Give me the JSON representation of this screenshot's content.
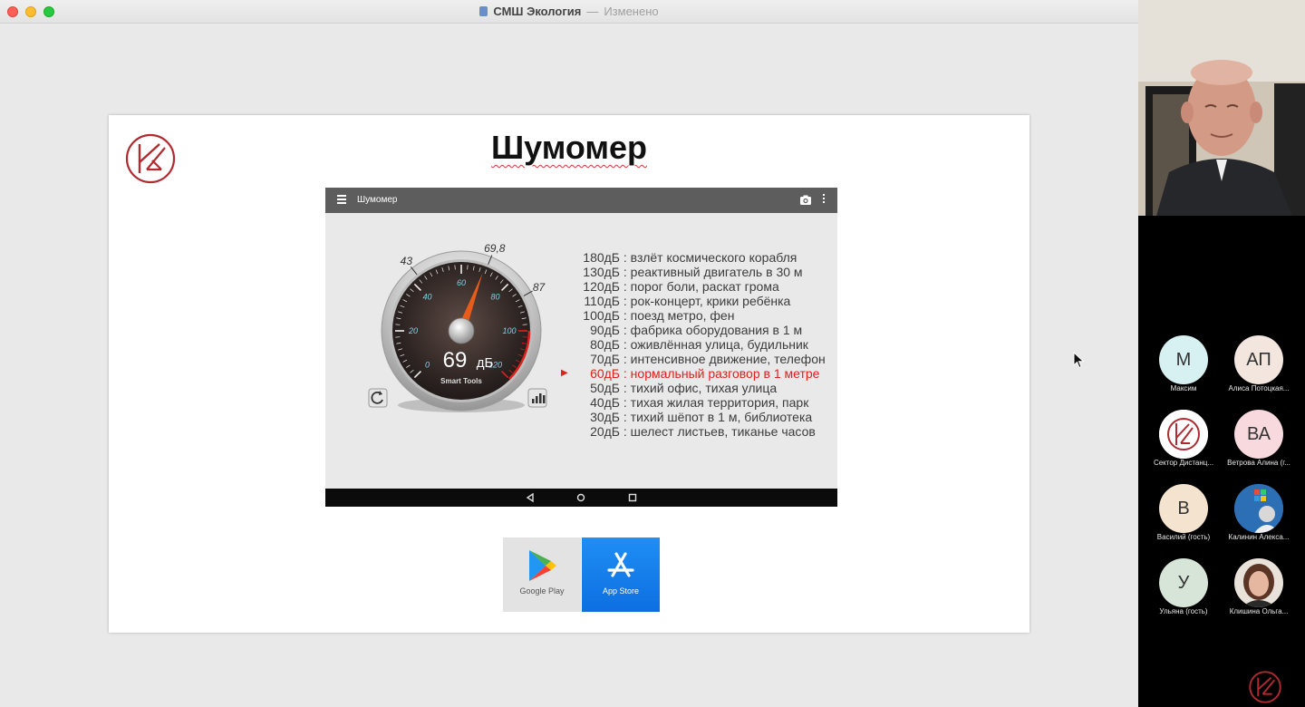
{
  "window": {
    "title": "СМШ Экология",
    "separator": "—",
    "state": "Изменено",
    "accent": "#ff5f57"
  },
  "slide": {
    "title": "Шумомер",
    "logo_icon": "sector-logo-icon",
    "brand_color": "#b02a30"
  },
  "app": {
    "title": "Шумомер",
    "gauge": {
      "reading": "69",
      "unit": "дБ",
      "brand": "Smart Tools",
      "scale": [
        "0",
        "20",
        "40",
        "60",
        "80",
        "100",
        "120"
      ],
      "outer_marks": [
        "43",
        "69,8",
        "87"
      ],
      "needle_value": 69
    },
    "levels": [
      {
        "value": "180дБ",
        "text": ": взлёт космического корабля",
        "active": false
      },
      {
        "value": "130дБ",
        "text": ": реактивный двигатель в 30 м",
        "active": false
      },
      {
        "value": "120дБ",
        "text": ": порог боли, раскат грома",
        "active": false
      },
      {
        "value": "110дБ",
        "text": ": рок-концерт, крики ребёнка",
        "active": false
      },
      {
        "value": "100дБ",
        "text": ": поезд метро, фен",
        "active": false
      },
      {
        "value": "90дБ",
        "text": ": фабрика оборудования в 1 м",
        "active": false
      },
      {
        "value": "80дБ",
        "text": ": оживлённая улица, будильник",
        "active": false
      },
      {
        "value": "70дБ",
        "text": ": интенсивное движение, телефон",
        "active": false
      },
      {
        "value": "60дБ",
        "text": ": нормальный разговор в 1 метре",
        "active": true
      },
      {
        "value": "50дБ",
        "text": ": тихий офис, тихая улица",
        "active": false
      },
      {
        "value": "40дБ",
        "text": ": тихая жилая территория, парк",
        "active": false
      },
      {
        "value": "30дБ",
        "text": ": тихий шёпот в 1 м, библиотека",
        "active": false
      },
      {
        "value": "20дБ",
        "text": ": шелест листьев, тиканье часов",
        "active": false
      }
    ]
  },
  "stores": {
    "google_play": "Google Play",
    "app_store": "App Store"
  },
  "participants": [
    {
      "initials": "М",
      "name": "Максим",
      "color": "#d7f0f2"
    },
    {
      "initials": "АП",
      "name": "Алиса Потоцкая...",
      "color": "#f3e6df"
    },
    {
      "initials": "",
      "name": "Сектор Дистанц...",
      "color": "#ffffff"
    },
    {
      "initials": "ВА",
      "name": "Ветрова Алина (г...",
      "color": "#f7d9de"
    },
    {
      "initials": "В",
      "name": "Василий (гость)",
      "color": "#f4e4cf"
    },
    {
      "initials": "",
      "name": "Калинин Алекса...",
      "color": "#2c6fb5"
    },
    {
      "initials": "У",
      "name": "Ульяна (гость)",
      "color": "#d6e5d8"
    },
    {
      "initials": "",
      "name": "Клишина Ольга...",
      "color": "#7a5a48"
    }
  ]
}
